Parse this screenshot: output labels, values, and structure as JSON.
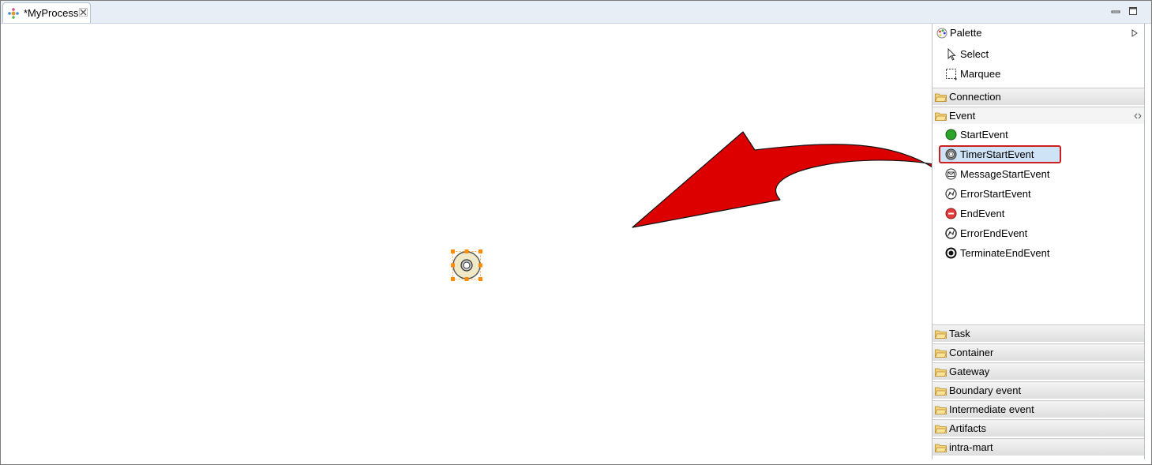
{
  "editor_tab": {
    "title": "*MyProcess"
  },
  "palette": {
    "title": "Palette",
    "tools": [
      {
        "label": "Select",
        "icon": "select-arrow-icon"
      },
      {
        "label": "Marquee",
        "icon": "marquee-icon"
      }
    ],
    "drawers_top": [
      {
        "label": "Connection"
      },
      {
        "label": "Event"
      }
    ],
    "event_items": [
      {
        "label": "StartEvent",
        "icon": "start-event-icon"
      },
      {
        "label": "TimerStartEvent",
        "icon": "timer-start-event-icon",
        "selected": true
      },
      {
        "label": "MessageStartEvent",
        "icon": "message-start-event-icon"
      },
      {
        "label": "ErrorStartEvent",
        "icon": "error-start-event-icon"
      },
      {
        "label": "EndEvent",
        "icon": "end-event-icon"
      },
      {
        "label": "ErrorEndEvent",
        "icon": "error-end-event-icon"
      },
      {
        "label": "TerminateEndEvent",
        "icon": "terminate-end-event-icon"
      }
    ],
    "drawers_bottom": [
      {
        "label": "Task"
      },
      {
        "label": "Container"
      },
      {
        "label": "Gateway"
      },
      {
        "label": "Boundary event"
      },
      {
        "label": "Intermediate event"
      },
      {
        "label": "Artifacts"
      },
      {
        "label": "intra-mart"
      }
    ]
  },
  "colors": {
    "annotation_arrow": "#dd0000",
    "selection_handles": "#ff8c00",
    "selected_highlight_border": "#cc1f1f",
    "start_event_green": "#2aa52a",
    "end_event_red": "#e23c3c"
  }
}
